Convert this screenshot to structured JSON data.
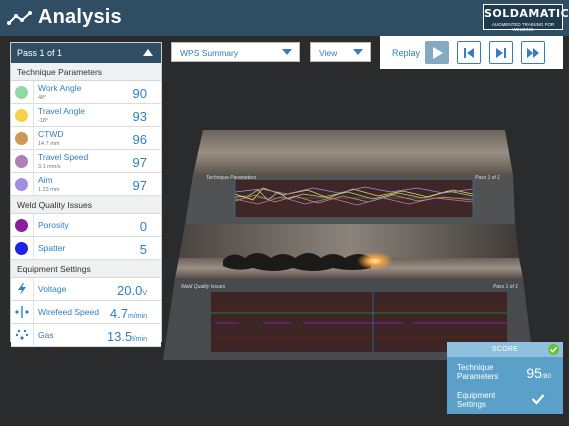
{
  "header": {
    "title": "Analysis",
    "brand_name": "SOLDAMATIC",
    "brand_tagline": "AUGMENTED TRAINING FOR WELDING"
  },
  "pass_selector": {
    "label": "Pass 1 of 1"
  },
  "technique": {
    "section_label": "Technique Parameters",
    "items": [
      {
        "label": "Work Angle",
        "sub": "48°",
        "value": "90",
        "color": "#8fd9a8"
      },
      {
        "label": "Travel Angle",
        "sub": "-18°",
        "value": "93",
        "color": "#f5d24a"
      },
      {
        "label": "CTWD",
        "sub": "14.7 mm",
        "value": "96",
        "color": "#c99a57"
      },
      {
        "label": "Travel Speed",
        "sub": "3.1 mm/s",
        "value": "97",
        "color": "#b07fb3"
      },
      {
        "label": "Aim",
        "sub": "1.23 mm",
        "value": "97",
        "color": "#a08ee0"
      }
    ]
  },
  "weld_quality": {
    "section_label": "Weld Quality Issues",
    "items": [
      {
        "label": "Porosity",
        "value": "0",
        "color": "#8a1f9e"
      },
      {
        "label": "Spatter",
        "value": "5",
        "color": "#1e22e6"
      }
    ]
  },
  "equipment": {
    "section_label": "Equipment Settings",
    "items": [
      {
        "label": "Voltage",
        "value": "20.0",
        "unit": "V",
        "icon": "lightning-icon"
      },
      {
        "label": "Wirefeed Speed",
        "value": "4.7",
        "unit": "m/min",
        "icon": "wirefeed-icon"
      },
      {
        "label": "Gas",
        "value": "13.5",
        "unit": "l/min",
        "icon": "gas-icon"
      }
    ]
  },
  "toolbar": {
    "wps_label": "WPS Summary",
    "view_label": "View",
    "replay_label": "Replay"
  },
  "scene": {
    "technique_label": "Technique Parameters",
    "technique_pass": "Pass 1 of 1",
    "quality_label": "Weld Quality Issues",
    "quality_pass": "Pass 1 of 1"
  },
  "score": {
    "title": "SCORE",
    "technique_label_1": "Technique",
    "technique_label_2": "Parameters",
    "technique_value": "95",
    "technique_max": "/80",
    "equipment_label_1": "Equipment",
    "equipment_label_2": "Settings"
  },
  "colors": {
    "header_bg": "#2f4d63",
    "accent": "#2f7fc1",
    "score_bg": "#5ba0c9"
  }
}
